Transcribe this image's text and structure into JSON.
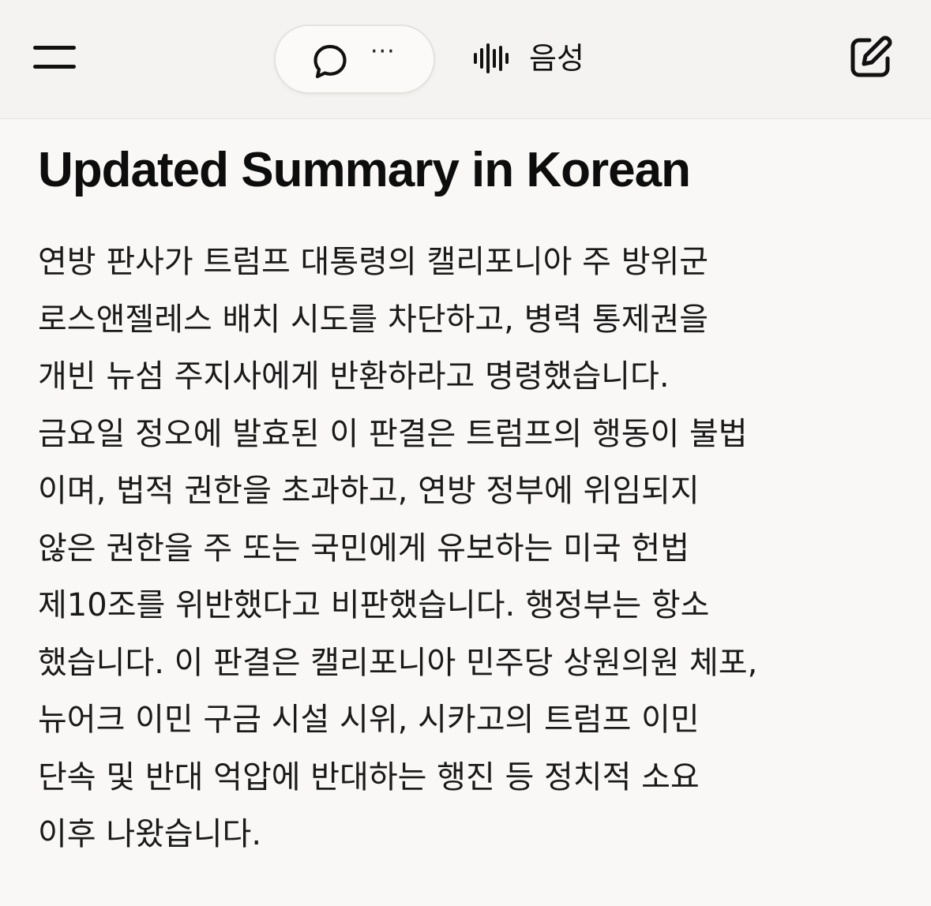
{
  "header": {
    "menu_icon": "hamburger-menu-icon",
    "chat_icon": "chat-bubble-icon",
    "more_label": "···",
    "voice_icon": "waveform-icon",
    "voice_label": "음성",
    "new_chat_icon": "edit-compose-icon"
  },
  "main": {
    "title": "Updated Summary in Korean",
    "paragraph_lines": [
      "연방 판사가 트럼프 대통령의 캘리포니아 주 방위군",
      "로스앤젤레스 배치 시도를 차단하고, 병력 통제권을",
      "개빈 뉴섬 주지사에게 반환하라고 명령했습니다.",
      "금요일 정오에 발효된 이 판결은 트럼프의 행동이 불법",
      "이며, 법적 권한을 초과하고, 연방 정부에 위임되지",
      "않은 권한을 주 또는 국민에게 유보하는 미국 헌법",
      "제10조를 위반했다고 비판했습니다. 행정부는 항소",
      "했습니다. 이 판결은 캘리포니아 민주당 상원의원 체포,",
      "뉴어크 이민 구금 시설 시위, 시카고의 트럼프 이민",
      "단속 및 반대 억압에 반대하는 행진 등 정치적 소요",
      "이후 나왔습니다."
    ]
  }
}
